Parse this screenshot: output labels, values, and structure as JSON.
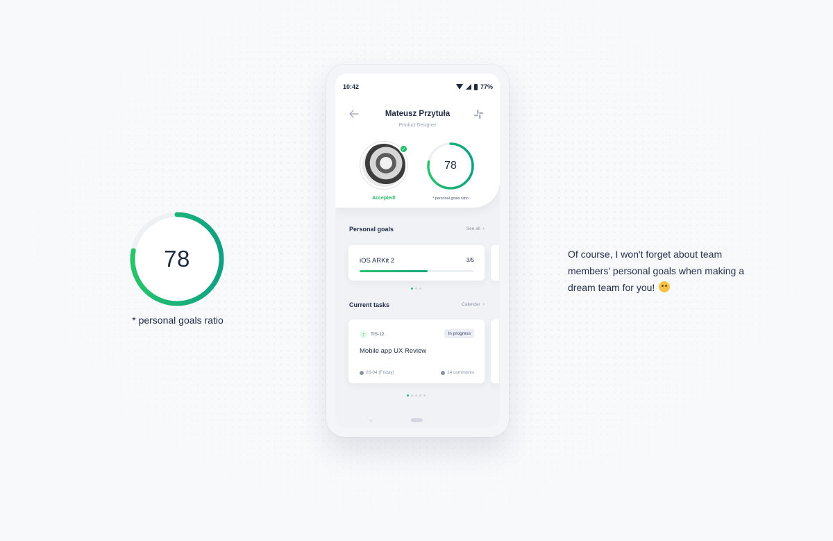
{
  "phone": {
    "status_bar": {
      "time": "10:42",
      "battery": "77%"
    },
    "header": {
      "name": "Mateusz Przytuła",
      "role": "Product Designer",
      "status_label": "Accepted!",
      "goals_ratio_value": "78",
      "goals_ratio_fraction": 0.78,
      "goals_ratio_caption": "* personal goals ratio"
    },
    "personal_goals": {
      "title": "Personal goals",
      "link": "See all",
      "goal": {
        "name": "iOS ARKit 2",
        "count": "3/5",
        "progress": 0.6
      }
    },
    "current_tasks": {
      "title": "Current tasks",
      "link": "Calendar",
      "task": {
        "id": "TIS-12",
        "status": "In progress",
        "title": "Mobile app UX Review",
        "date": "26-04 (Friday)",
        "comments": "14 comments"
      }
    }
  },
  "big_ring": {
    "value": "78",
    "fraction": 0.78,
    "caption": "* personal goals ratio"
  },
  "side_text": "Of course, I won't forget about team members' personal goals when making a dream team for you!",
  "colors": {
    "accent_green": "#1fbf6a",
    "ring_start": "#27c46b",
    "ring_end": "#0fa184",
    "text": "#1f2a44"
  }
}
